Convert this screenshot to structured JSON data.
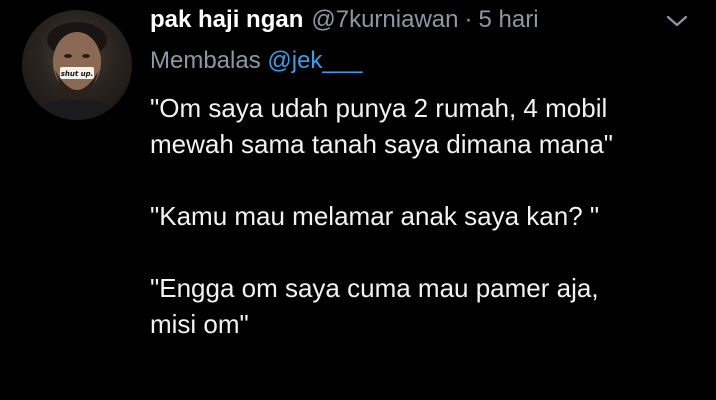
{
  "tweet": {
    "display_name": "pak haji ngan",
    "handle": "@7kurniawan",
    "separator": "·",
    "time": "5 hari",
    "replying_prefix": "Membalas",
    "replying_to": "@jek___",
    "avatar_caption": "shut up.",
    "paragraphs": [
      "\"Om saya udah punya 2 rumah, 4 mobil\nmewah sama tanah saya dimana mana\"",
      "\"Kamu mau melamar anak saya kan? \"",
      "\"Engga om saya cuma mau pamer aja,\nmisi om\""
    ]
  },
  "colors": {
    "background": "#000000",
    "primary_text": "#ffffff",
    "secondary_text": "#8b98a5",
    "mention": "#3b9de8"
  },
  "icons": {
    "menu": "chevron-down-icon"
  }
}
